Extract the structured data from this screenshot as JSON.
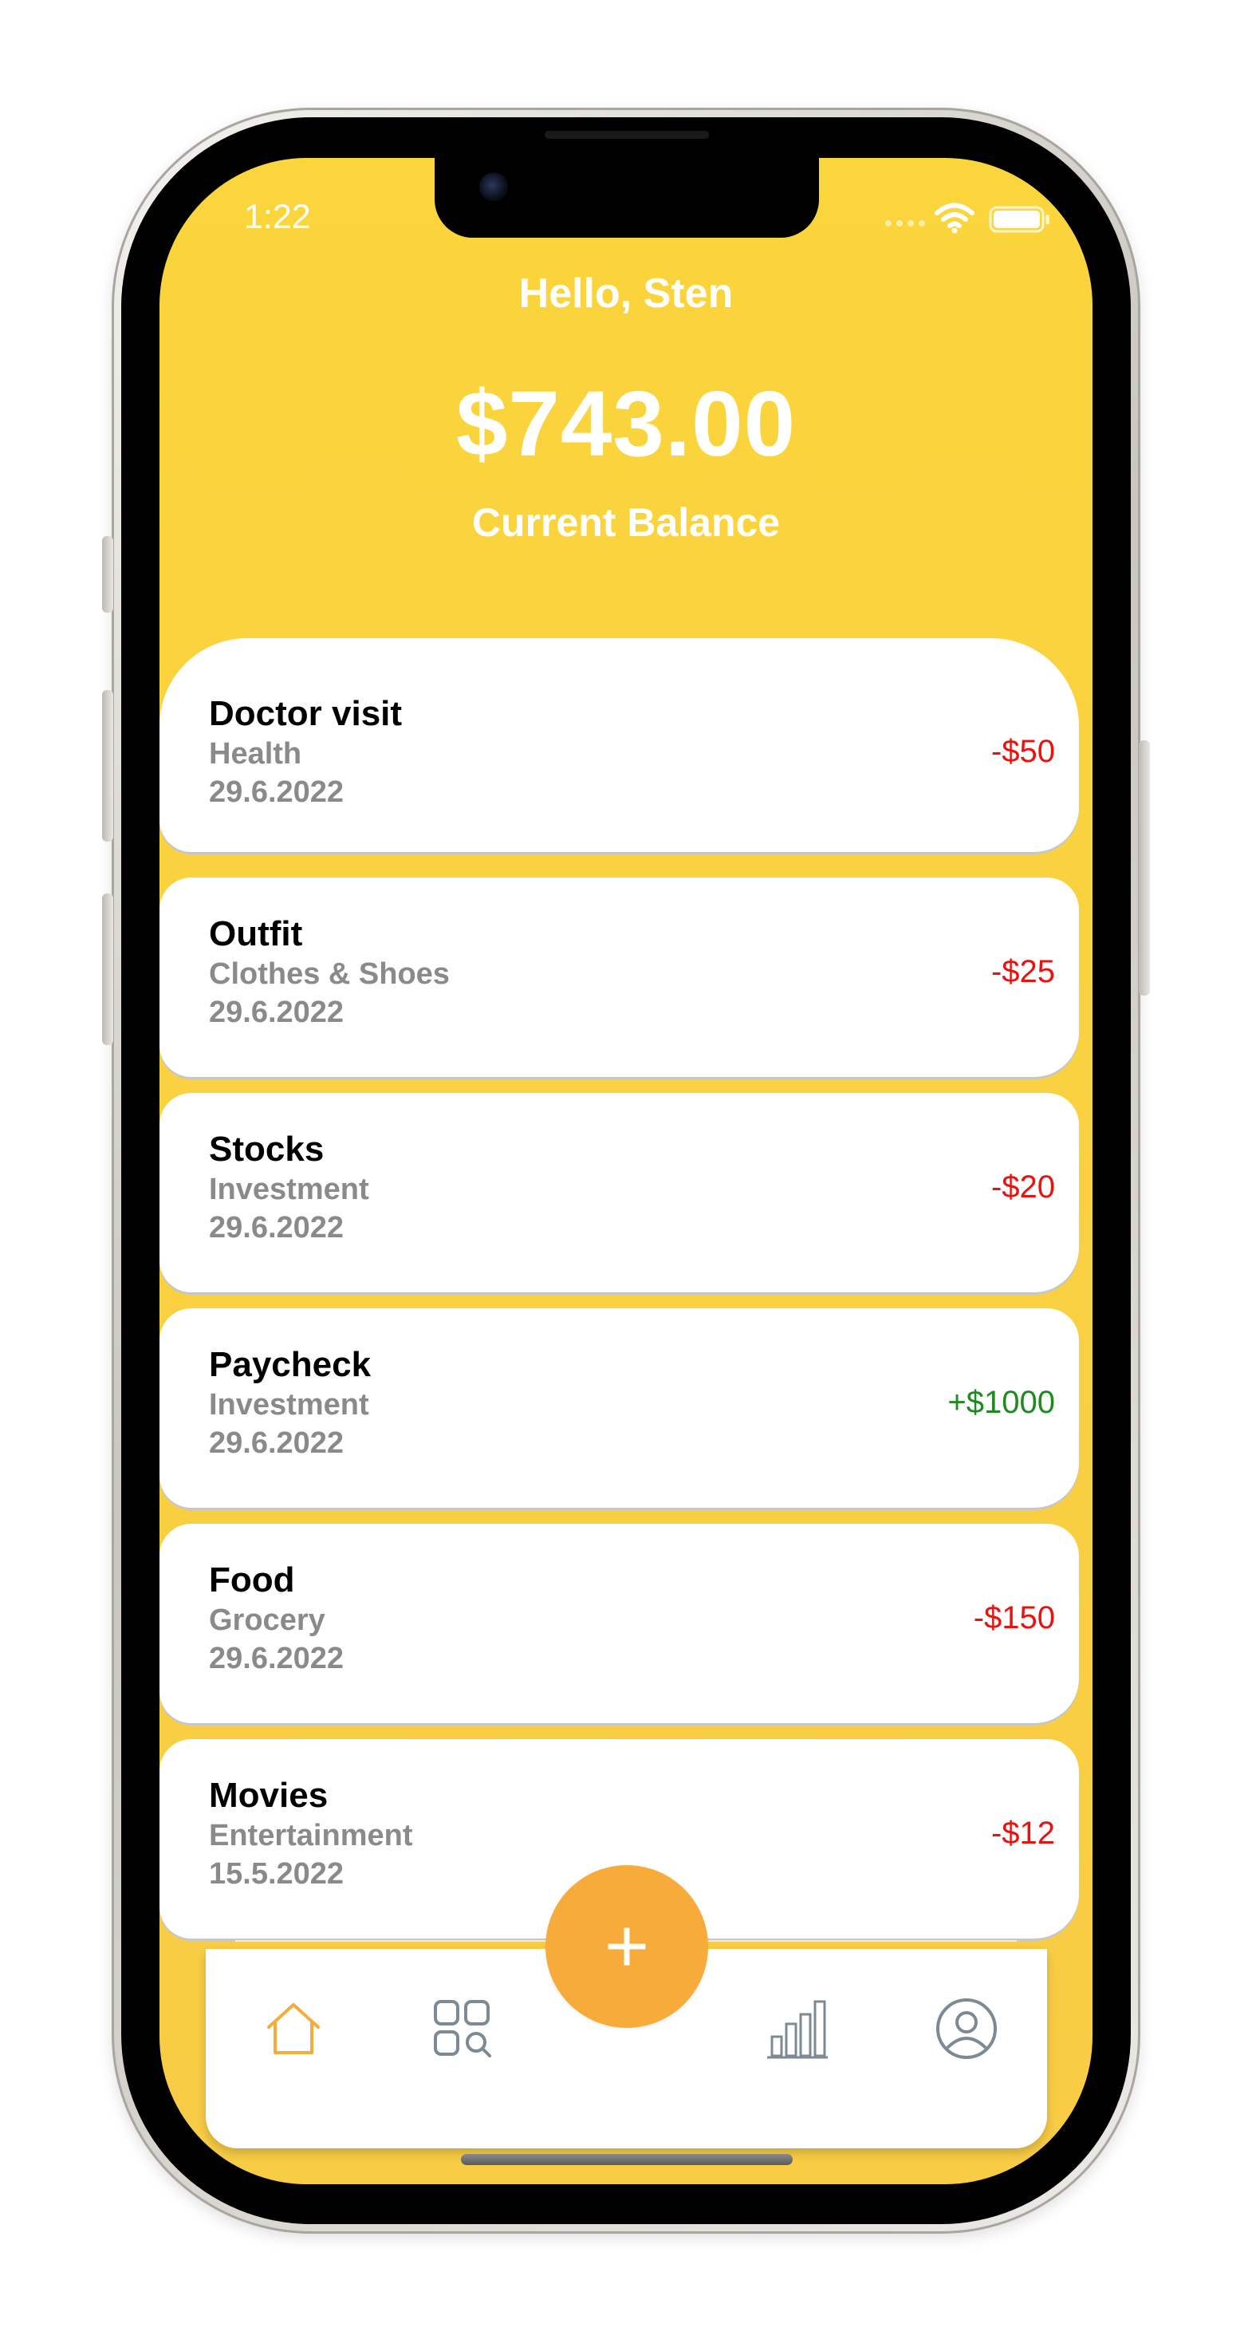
{
  "status_bar": {
    "time": "1:22",
    "icons": [
      "wifi-icon",
      "battery-icon"
    ]
  },
  "header": {
    "greeting": "Hello, Sten",
    "balance": "$743.00",
    "balance_label": "Current Balance"
  },
  "transactions": [
    {
      "title": "Doctor visit",
      "category": "Health",
      "date": "29.6.2022",
      "amount": "-$50",
      "type": "expense"
    },
    {
      "title": "Outfit",
      "category": "Clothes & Shoes",
      "date": "29.6.2022",
      "amount": "-$25",
      "type": "expense"
    },
    {
      "title": "Stocks",
      "category": "Investment",
      "date": "29.6.2022",
      "amount": "-$20",
      "type": "expense"
    },
    {
      "title": "Paycheck",
      "category": "Investment",
      "date": "29.6.2022",
      "amount": "+$1000",
      "type": "income"
    },
    {
      "title": "Food",
      "category": "Grocery",
      "date": "29.6.2022",
      "amount": "-$150",
      "type": "expense"
    },
    {
      "title": "Movies",
      "category": "Entertainment",
      "date": "15.5.2022",
      "amount": "-$12",
      "type": "expense"
    }
  ],
  "tab_bar": {
    "items": [
      {
        "icon": "home-icon",
        "active": true
      },
      {
        "icon": "categories-search-icon",
        "active": false
      },
      {
        "icon": "add-icon",
        "label": "+"
      },
      {
        "icon": "bar-chart-icon",
        "active": false
      },
      {
        "icon": "profile-icon",
        "active": false
      }
    ]
  },
  "colors": {
    "header_yellow": "#fbd53c",
    "accent_orange": "#f6ab3b",
    "expense_red": "#e8130e",
    "income_green": "#1f8a1f",
    "muted_gray": "#8a8a8a",
    "inactive_icon": "#7c8a94"
  }
}
